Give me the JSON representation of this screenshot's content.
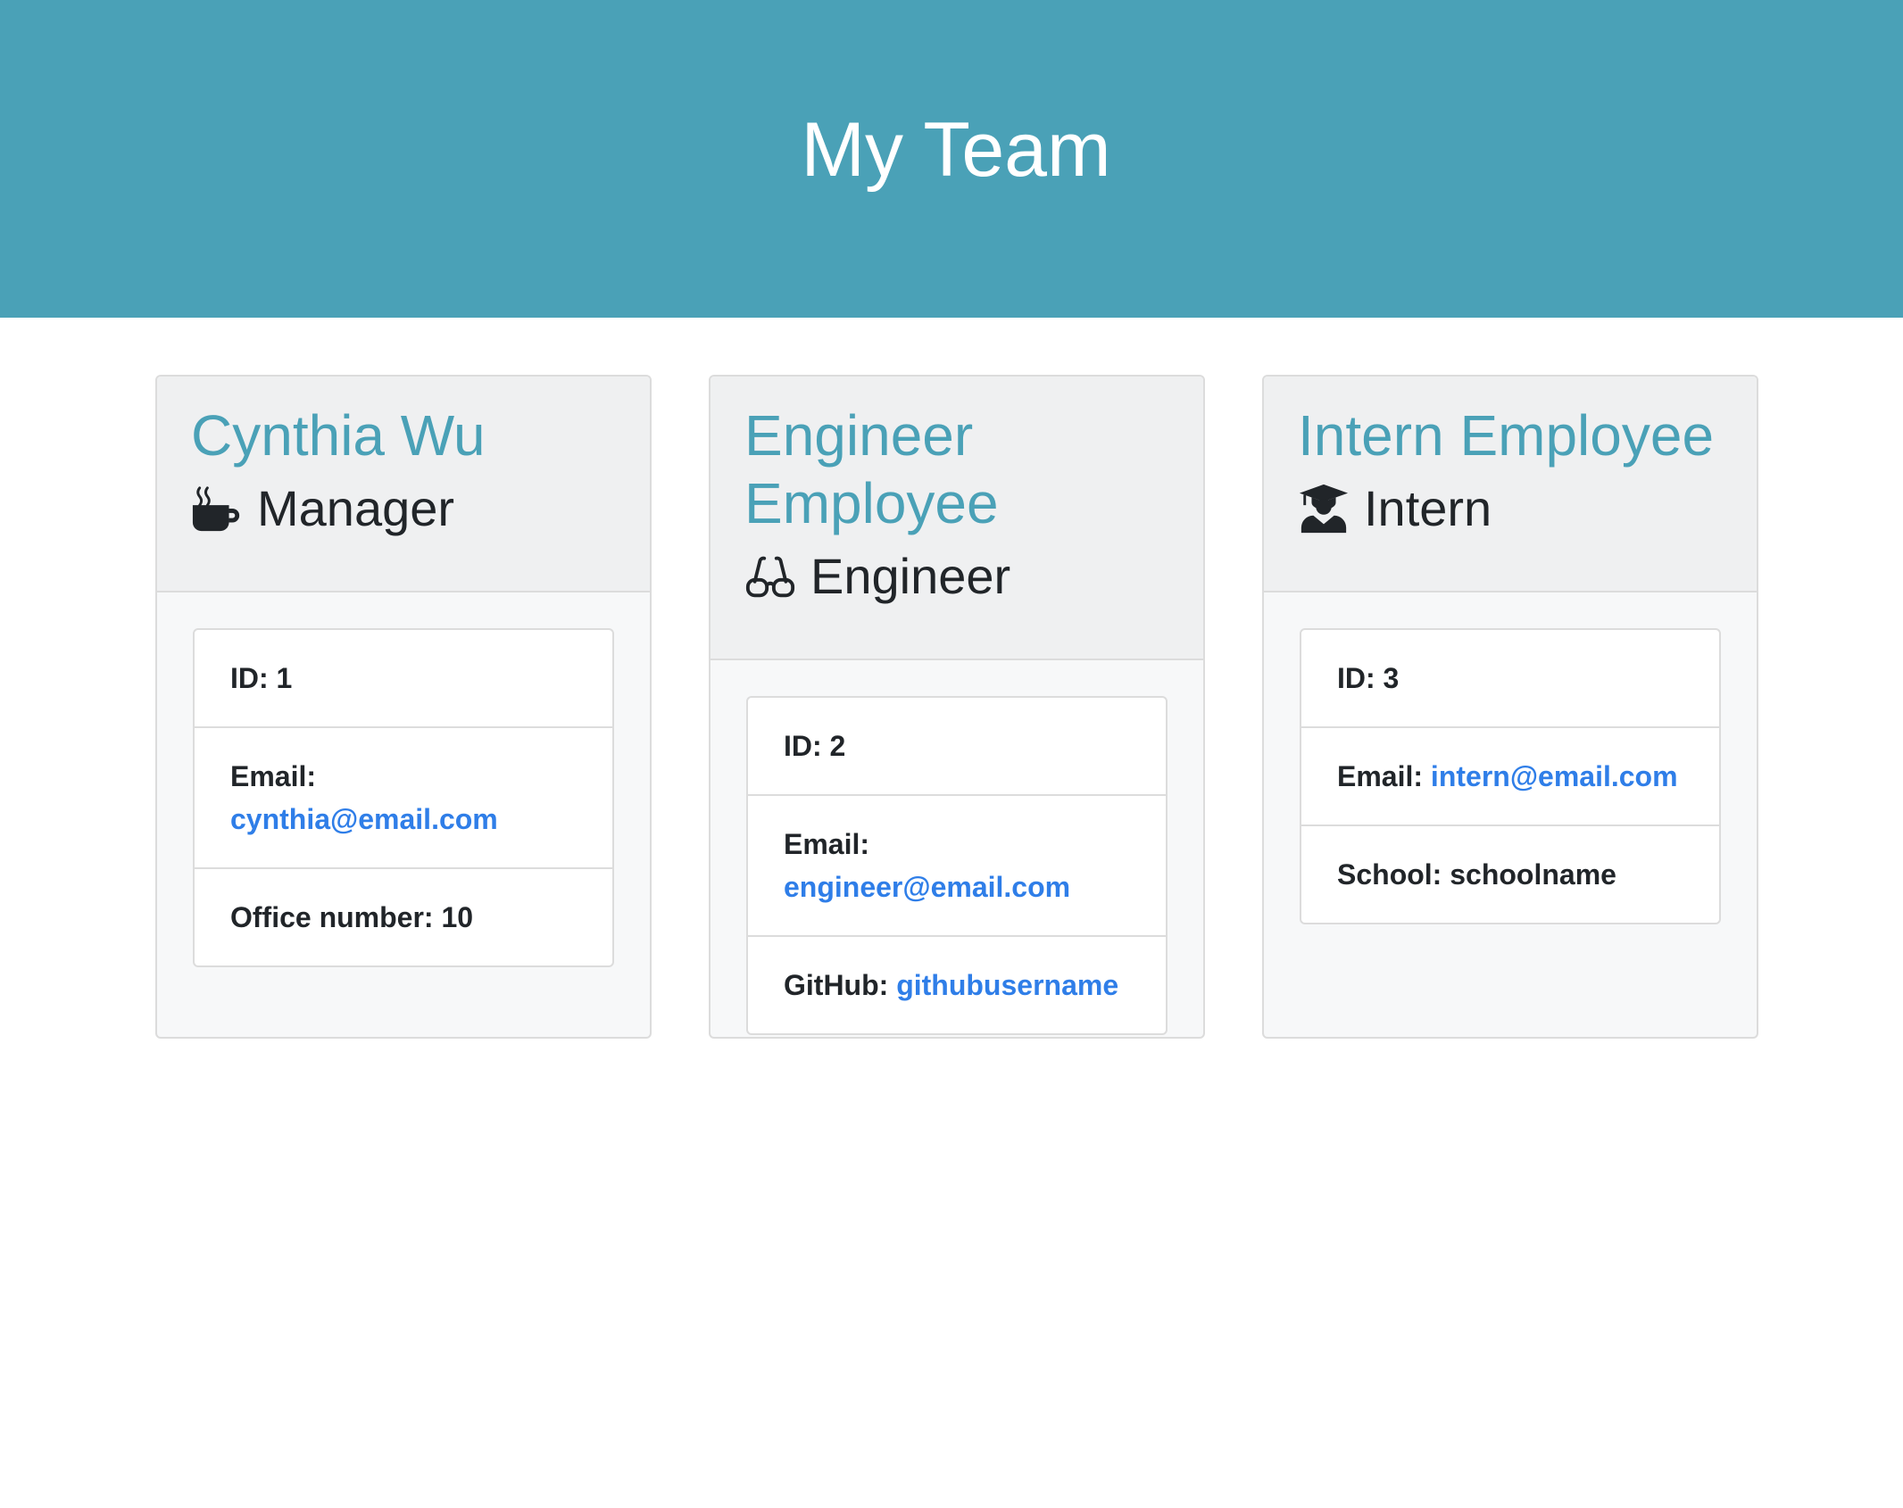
{
  "header": {
    "title": "My Team"
  },
  "colors": {
    "accent": "#4aa1b7",
    "link": "#2f7ee8",
    "header_bg": "#eff0f1",
    "body_bg": "#f7f8f9"
  },
  "employees": [
    {
      "name": "Cynthia Wu",
      "role": "Manager",
      "role_icon": "coffee-mug-icon",
      "id_label": "ID:",
      "id": "1",
      "email_label": "Email:",
      "email": "cynthia@email.com",
      "extra_label": "Office number:",
      "extra_value": "10"
    },
    {
      "name": "Engineer Employee",
      "role": "Engineer",
      "role_icon": "glasses-icon",
      "id_label": "ID:",
      "id": "2",
      "email_label": "Email:",
      "email": "engineer@email.com",
      "extra_label": "GitHub:",
      "extra_value": "githubusername"
    },
    {
      "name": "Intern Employee",
      "role": "Intern",
      "role_icon": "graduate-icon",
      "id_label": "ID:",
      "id": "3",
      "email_label": "Email:",
      "email": "intern@email.com",
      "extra_label": "School:",
      "extra_value": "schoolname"
    }
  ]
}
